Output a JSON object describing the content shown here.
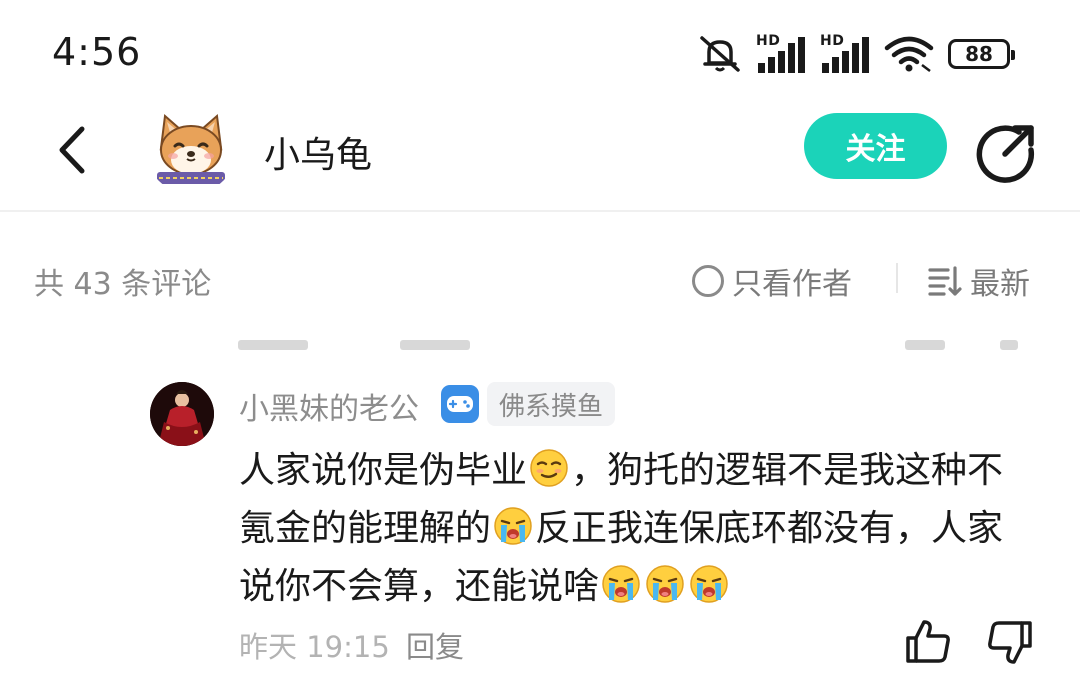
{
  "status_bar": {
    "time": "4:56",
    "battery": "88",
    "hd_label_1": "HD",
    "hd_label_2": "HD"
  },
  "header": {
    "username": "小乌龟",
    "follow_label": "关注"
  },
  "comment_bar": {
    "count_text": "共 43 条评论",
    "author_only_label": "只看作者",
    "sort_label": "最新"
  },
  "reply": {
    "author": "小黑妹的老公",
    "tag": "佛系摸鱼",
    "text_part1": "人家说你是伪毕业",
    "text_part2": "，狗托的逻辑不是我这种不氪金的能理解的",
    "text_part3": "反正我连保底环都没有，人家说你不会算，还能说啥",
    "time": "昨天 19:15",
    "reply_label": "回复"
  },
  "colors": {
    "accent": "#1bd3b9",
    "muted_text": "#8a8a8a",
    "badge_blue": "#3a8ee6"
  }
}
